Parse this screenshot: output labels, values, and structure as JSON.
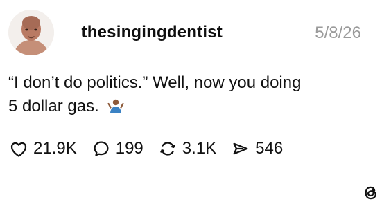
{
  "post": {
    "author": {
      "username": "_thesingingdentist",
      "avatar_icon": "profile-avatar"
    },
    "date": "5/8/26",
    "text_line_1": "“I don’t do politics.” Well, now you doing",
    "text_line_2": "5 dollar gas.",
    "emoji_icon": "shrug-person-icon",
    "actions": {
      "likes": "21.9K",
      "comments": "199",
      "reposts": "3.1K",
      "shares": "546"
    },
    "brand_icon": "threads-logo-icon"
  },
  "colors": {
    "text": "#111111",
    "muted": "#9a9a9a",
    "background": "#ffffff"
  }
}
